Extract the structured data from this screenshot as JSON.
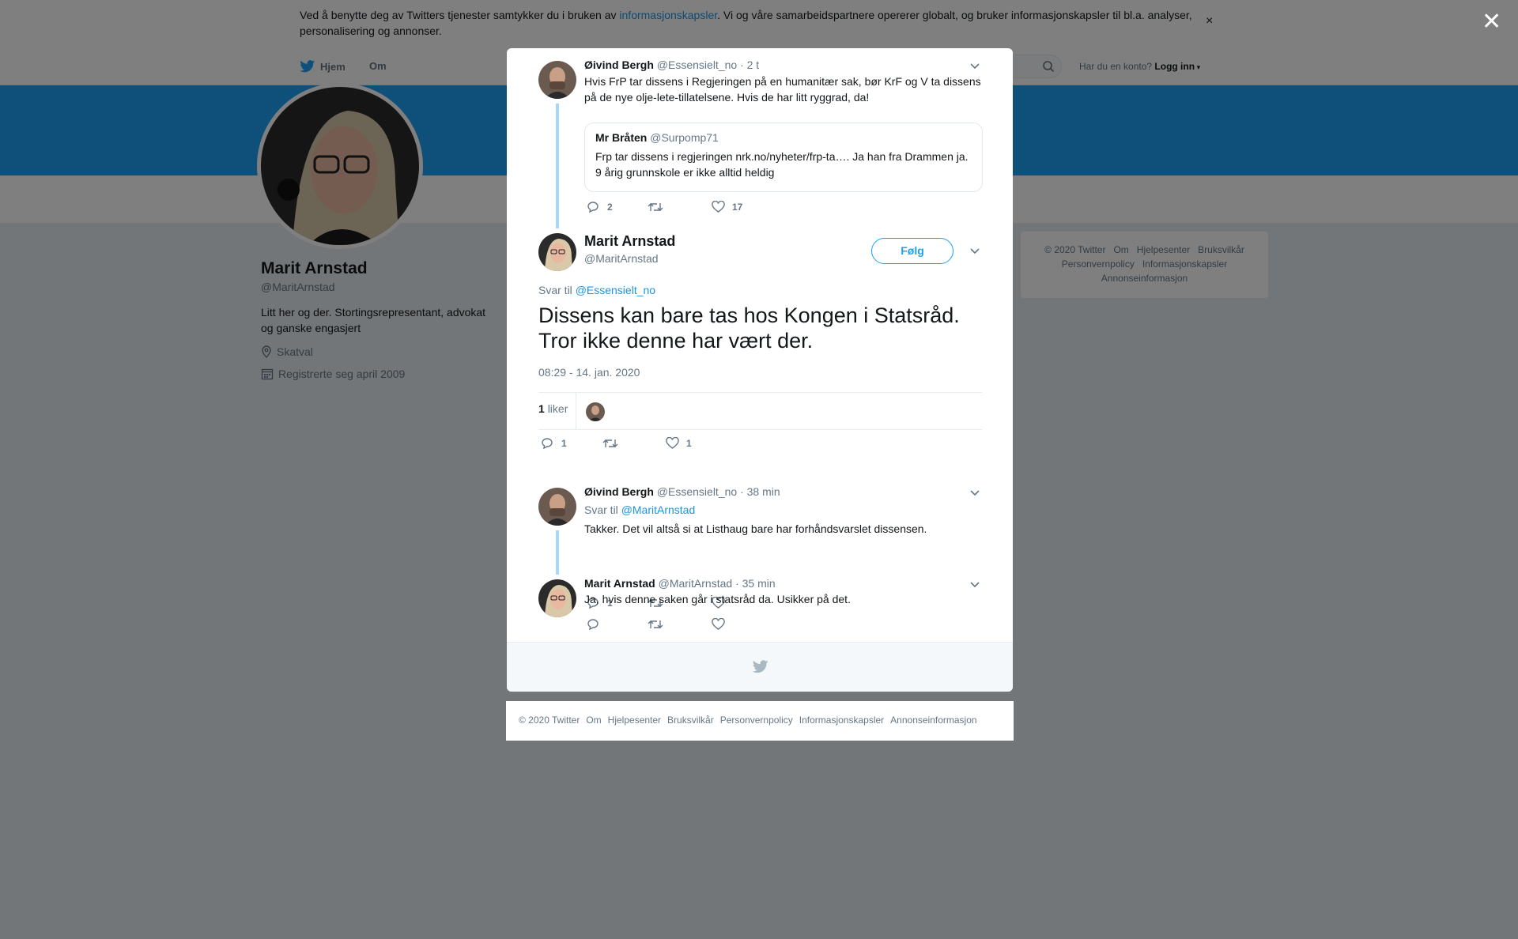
{
  "cookie": {
    "text_before": "Ved å benytte deg av Twitters tjenester samtykker du i bruken av ",
    "link": "informasjonskapsler",
    "text_after": ". Vi og våre samarbeidspartnere opererer globalt, og bruker informasjonskapsler til bl.a. analyser, personalisering og annonser.",
    "close": "×"
  },
  "nav": {
    "home": "Hjem",
    "about": "Om",
    "account_question": "Har du en konto?",
    "login": "Logg inn"
  },
  "profile": {
    "name": "Marit Arnstad",
    "handle": "@MaritArnstad",
    "bio": "Litt her og der. Stortingsrepresentant, advokat og ganske engasjert",
    "location": "Skatval",
    "joined": "Registrerte seg april 2009"
  },
  "side_footer": {
    "row1": [
      "© 2020 Twitter",
      "Om",
      "Hjelpesenter",
      "Bruksvilkår"
    ],
    "row2": [
      "Personvernpolicy",
      "Informasjonskapsler"
    ],
    "row3": [
      "Annonseinformasjon"
    ]
  },
  "overlay_close": "✕",
  "modal": {
    "parent": {
      "name": "Øivind Bergh",
      "handle": "@Essensielt_no",
      "time": "· 2 t",
      "text": "Hvis FrP tar dissens i Regjeringen på en humanitær sak, bør KrF og V ta dissens på de nye olje-lete-tillatelsene. Hvis de har litt ryggrad, da!",
      "quote": {
        "name": "Mr Bråten",
        "handle": "@Surpomp71",
        "text": "Frp tar dissens i regjeringen nrk.no/nyheter/frp-ta….  Ja han fra Drammen ja. 9 årig grunnskole er ikke alltid heldig"
      },
      "replies": "2",
      "likes": "17"
    },
    "main": {
      "name": "Marit Arnstad",
      "handle": "@MaritArnstad",
      "follow": "Følg",
      "reply_label": "Svar til",
      "reply_handle": "@Essensielt_no",
      "text": "Dissens kan bare tas hos Kongen i Statsråd. Tror ikke denne har vært der.",
      "timestamp": "08:29 - 14. jan. 2020",
      "like_count": "1",
      "like_label": "liker",
      "replies": "1",
      "likes": "1"
    },
    "reply1": {
      "name": "Øivind Bergh",
      "handle": "@Essensielt_no",
      "time": "· 38 min",
      "reply_label": "Svar til",
      "reply_handle": "@MaritArnstad",
      "text": "Takker. Det vil altså si at Listhaug bare har forhåndsvarslet dissensen.",
      "replies": "1"
    },
    "reply2": {
      "name": "Marit Arnstad",
      "handle": "@MaritArnstad",
      "time": "· 35 min",
      "text": "Ja, hvis denne saken går i statsråd da. Usikker på det."
    }
  },
  "bottom_footer": [
    "© 2020 Twitter",
    "Om",
    "Hjelpesenter",
    "Bruksvilkår",
    "Personvernpolicy",
    "Informasjonskapsler",
    "Annonseinformasjon"
  ],
  "colors": {
    "accent": "#1da1f2",
    "link": "#1b95e0",
    "thread_line": "#a4d9f9",
    "muted": "#657786"
  },
  "icons": [
    "twitter-bird-icon",
    "search-icon",
    "location-icon",
    "calendar-icon",
    "reply-icon",
    "retweet-icon",
    "like-icon",
    "chevron-down-icon",
    "close-icon"
  ]
}
